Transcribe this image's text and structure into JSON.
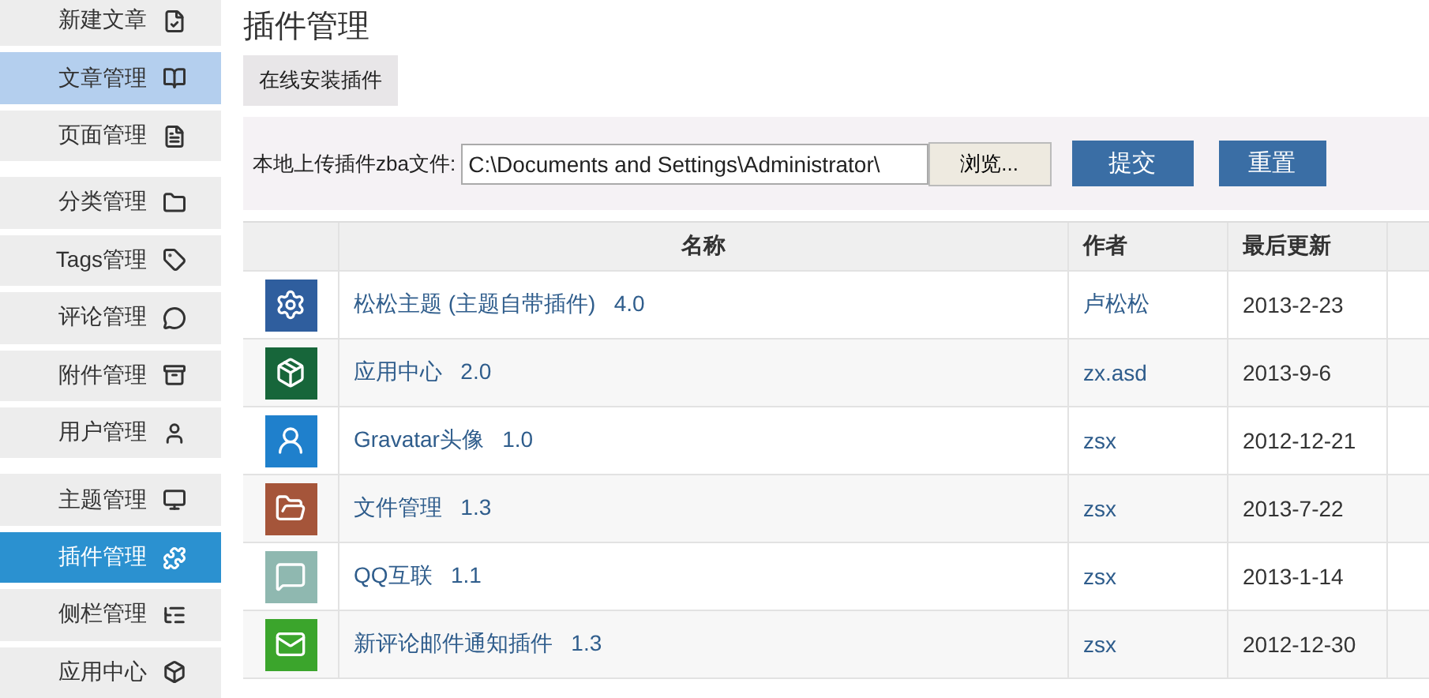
{
  "sidebar": {
    "items": [
      {
        "label": "新建文章",
        "selected": false,
        "highlighted": false,
        "group_end": false
      },
      {
        "label": "文章管理",
        "selected": false,
        "highlighted": true,
        "group_end": false
      },
      {
        "label": "页面管理",
        "selected": false,
        "highlighted": false,
        "group_end": true
      },
      {
        "label": "分类管理",
        "selected": false,
        "highlighted": false,
        "group_end": false
      },
      {
        "label": "Tags管理",
        "selected": false,
        "highlighted": false,
        "group_end": false
      },
      {
        "label": "评论管理",
        "selected": false,
        "highlighted": false,
        "group_end": false
      },
      {
        "label": "附件管理",
        "selected": false,
        "highlighted": false,
        "group_end": false
      },
      {
        "label": "用户管理",
        "selected": false,
        "highlighted": false,
        "group_end": true
      },
      {
        "label": "主题管理",
        "selected": false,
        "highlighted": false,
        "group_end": false
      },
      {
        "label": "插件管理",
        "selected": true,
        "highlighted": false,
        "group_end": false
      },
      {
        "label": "侧栏管理",
        "selected": false,
        "highlighted": false,
        "group_end": false
      },
      {
        "label": "应用中心",
        "selected": false,
        "highlighted": false,
        "group_end": false
      }
    ]
  },
  "page_title": "插件管理",
  "tabs": [
    {
      "label": "在线安装插件",
      "selected": false
    }
  ],
  "upload": {
    "label": "本地上传插件zba文件:",
    "value": "C:\\Documents and Settings\\Administrator\\",
    "browse": "浏览...",
    "submit": "提交",
    "reset": "重置"
  },
  "table": {
    "columns": [
      "名称",
      "作者",
      "最后更新"
    ],
    "rows": [
      {
        "name": "松松主题 (主题自带插件)   4.0",
        "author": "卢松松",
        "date": "2013-2-23",
        "color": "#2f5e9e"
      },
      {
        "name": "应用中心   2.0",
        "author": "zx.asd",
        "date": "2013-9-6",
        "color": "#17663a"
      },
      {
        "name": "Gravatar头像   1.0",
        "author": "zsx",
        "date": "2012-12-21",
        "color": "#1f80cc"
      },
      {
        "name": "文件管理   1.3",
        "author": "zsx",
        "date": "2013-7-22",
        "color": "#a5553a"
      },
      {
        "name": "QQ互联   1.1",
        "author": "zsx",
        "date": "2013-1-14",
        "color": "#8fb8b0"
      },
      {
        "name": "新评论邮件通知插件   1.3",
        "author": "zsx",
        "date": "2012-12-30",
        "color": "#3ba52c"
      }
    ]
  }
}
